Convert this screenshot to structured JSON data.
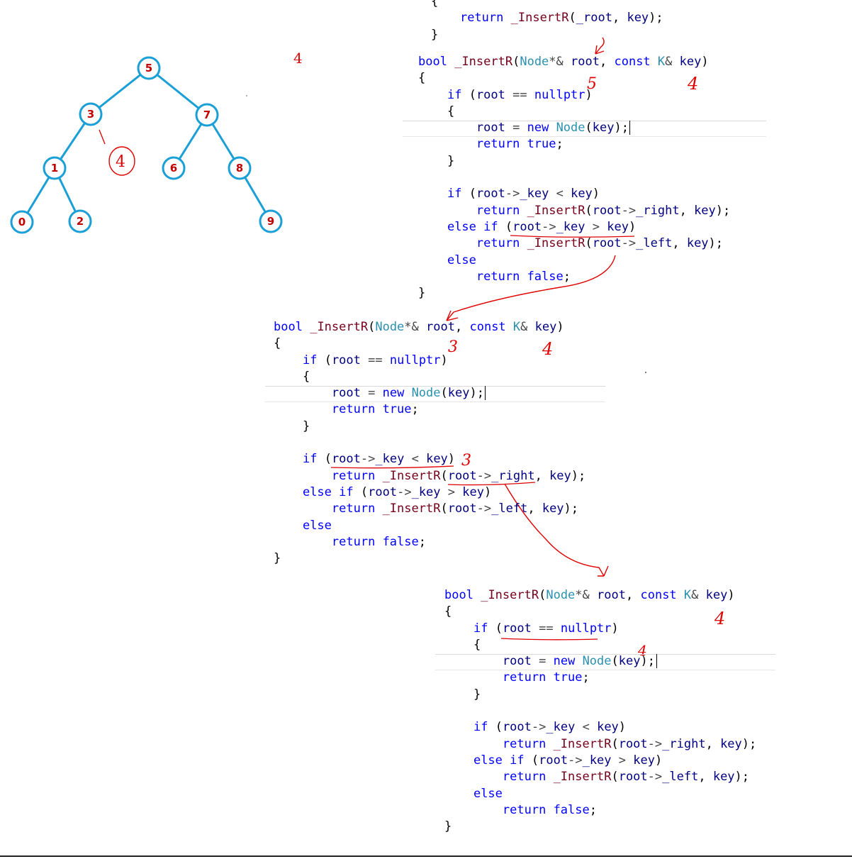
{
  "tree": {
    "nodes": [
      {
        "id": "5",
        "label": "5"
      },
      {
        "id": "3",
        "label": "3"
      },
      {
        "id": "7",
        "label": "7"
      },
      {
        "id": "1",
        "label": "1"
      },
      {
        "id": "6",
        "label": "6"
      },
      {
        "id": "8",
        "label": "8"
      },
      {
        "id": "0",
        "label": "0"
      },
      {
        "id": "2",
        "label": "2"
      },
      {
        "id": "9",
        "label": "9"
      }
    ],
    "edges": [
      [
        "5",
        "3"
      ],
      [
        "5",
        "7"
      ],
      [
        "3",
        "1"
      ],
      [
        "7",
        "6"
      ],
      [
        "7",
        "8"
      ],
      [
        "1",
        "0"
      ],
      [
        "1",
        "2"
      ],
      [
        "8",
        "9"
      ]
    ],
    "inserted_node": "4",
    "inserted_marker": "\\"
  },
  "insert_value_label": "4",
  "annotations": {
    "a1_root": "5",
    "a1_key": "4",
    "a2_root": "3",
    "a2_key": "4",
    "a2_compare": "3",
    "a3_key": "4",
    "a3_new": "4"
  },
  "code_top": {
    "lines": [
      "{",
      "    return _InsertR(_root, key);",
      "}"
    ]
  },
  "code_blocks": [
    {
      "lines": [
        "bool _InsertR(Node*& root, const K& key)",
        "{",
        "    if (root == nullptr)",
        "    {",
        "        root = new Node(key);",
        "        return true;",
        "    }",
        "",
        "    if (root->_key < key)",
        "        return _InsertR(root->_right, key);",
        "    else if (root->_key > key)",
        "        return _InsertR(root->_left, key);",
        "    else",
        "        return false;",
        "}"
      ]
    },
    {
      "lines": [
        "bool _InsertR(Node*& root, const K& key)",
        "{",
        "    if (root == nullptr)",
        "    {",
        "        root = new Node(key);",
        "        return true;",
        "    }",
        "",
        "    if (root->_key < key)",
        "        return _InsertR(root->_right, key);",
        "    else if (root->_key > key)",
        "        return _InsertR(root->_left, key);",
        "    else",
        "        return false;",
        "}"
      ]
    },
    {
      "lines": [
        "bool _InsertR(Node*& root, const K& key)",
        "{",
        "    if (root == nullptr)",
        "    {",
        "        root = new Node(key);",
        "        return true;",
        "    }",
        "",
        "    if (root->_key < key)",
        "        return _InsertR(root->_right, key);",
        "    else if (root->_key > key)",
        "        return _InsertR(root->_left, key);",
        "    else",
        "        return false;",
        "}"
      ]
    }
  ],
  "colors": {
    "tree_edge": "#1a9fd6",
    "tree_node_stroke": "#1a9fd6",
    "tree_node_label": "#c00000",
    "handwriting": "#e00000",
    "keyword": "#0000ff",
    "function": "#74001b",
    "type": "#2b91af"
  }
}
